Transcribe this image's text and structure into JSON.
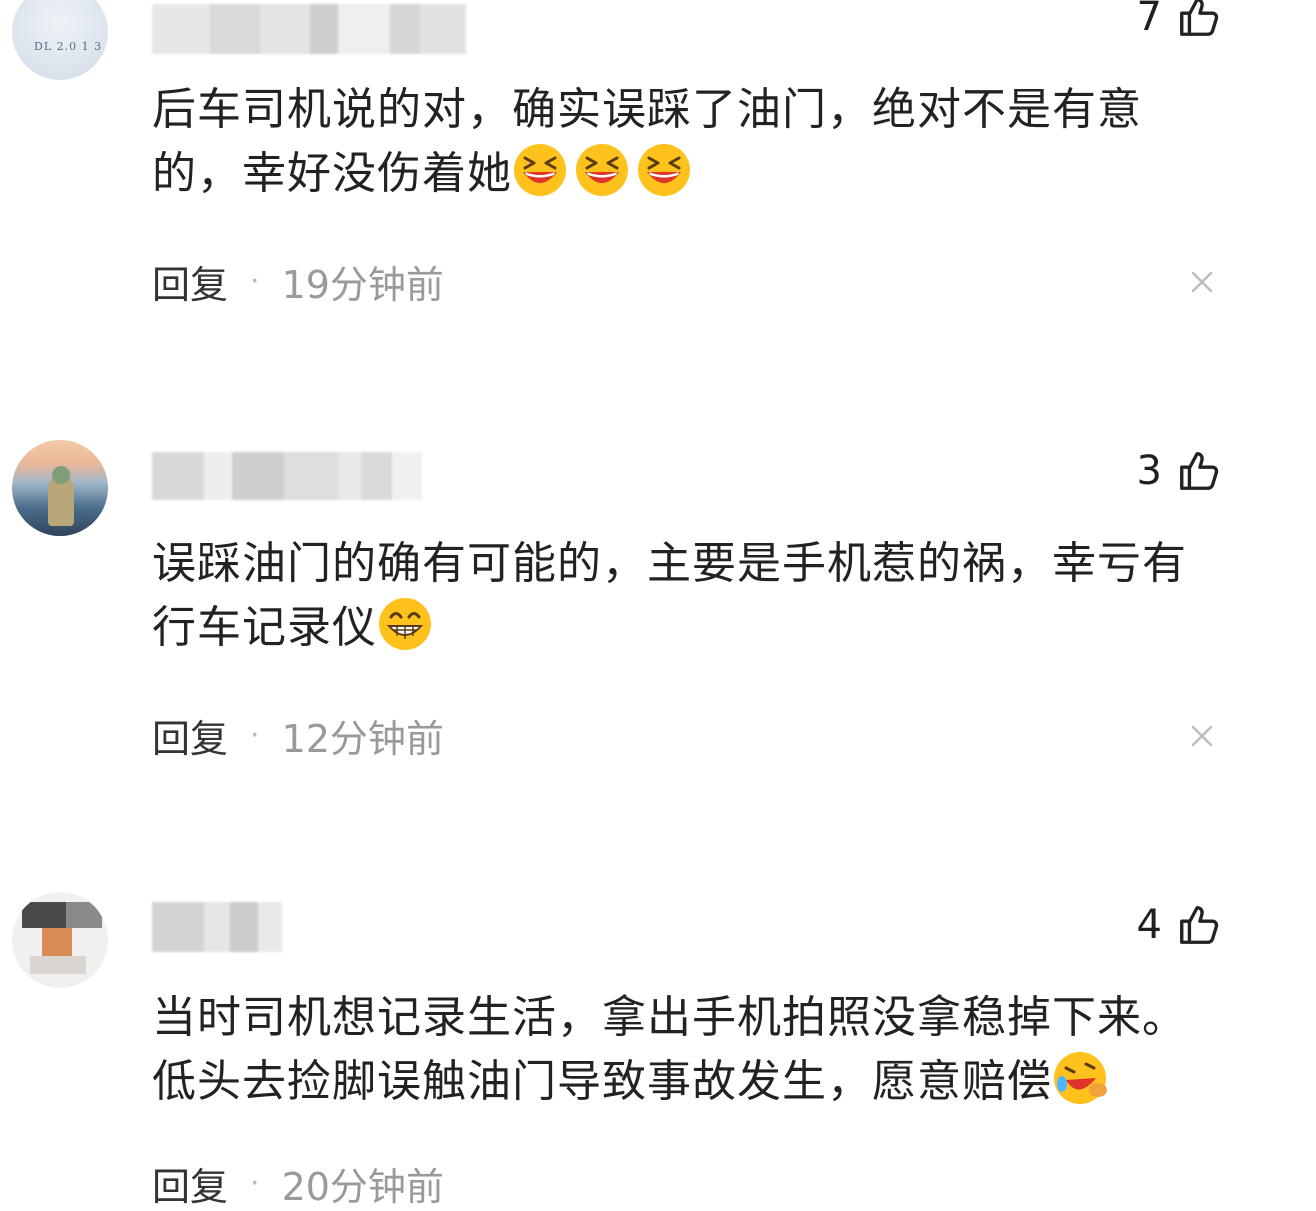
{
  "comments": [
    {
      "likes": "7",
      "text": "后车司机说的对，确实误踩了油门，绝对不是有意的，幸好没伤着她",
      "reply_label": "回复",
      "separator": "·",
      "time": "19分钟前",
      "emoji_name": "grinning-squinting-face",
      "avatar_text": "DL 2.0 1 3"
    },
    {
      "likes": "3",
      "text": "误踩油门的确有可能的，主要是手机惹的祸，幸亏有行车记录仪",
      "reply_label": "回复",
      "separator": "·",
      "time": "12分钟前",
      "emoji_name": "beaming-face-with-teeth"
    },
    {
      "likes": "4",
      "text": "当时司机想记录生活，拿出手机拍照没拿稳掉下来。低头去捡脚误触油门导致事故发生，愿意赔偿",
      "reply_label": "回复",
      "separator": "·",
      "time": "20分钟前",
      "emoji_name": "rolling-on-floor-laughing"
    }
  ],
  "icons": {
    "like": "thumbs-up-outline-icon",
    "dismiss": "close-x-icon"
  },
  "colors": {
    "text": "#222222",
    "secondary": "#9a9a9a",
    "emoji_yellow": "#ffc21c",
    "emoji_mouth": "#e0332b"
  }
}
